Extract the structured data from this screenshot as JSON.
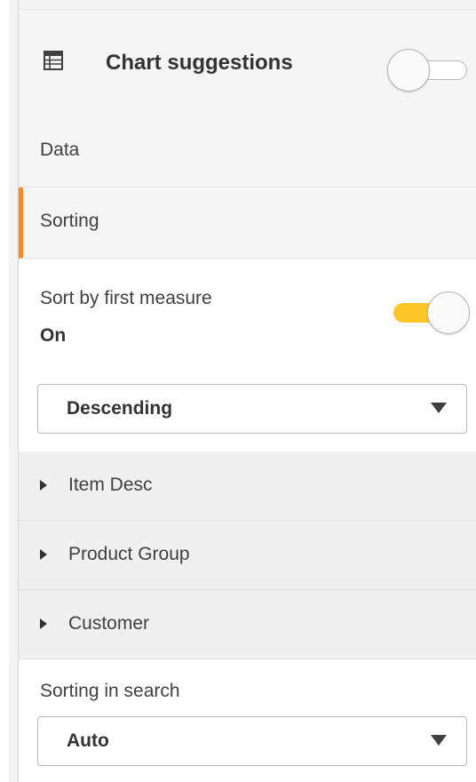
{
  "header": {
    "title": "Chart suggestions",
    "icon": "table-icon",
    "toggle_on": false
  },
  "nav": {
    "data_label": "Data",
    "sorting_label": "Sorting"
  },
  "sort": {
    "label": "Sort by first measure",
    "state": "On",
    "toggle_on": true,
    "order": "Descending"
  },
  "fields": [
    {
      "label": "Item Desc"
    },
    {
      "label": "Product Group"
    },
    {
      "label": "Customer"
    }
  ],
  "search": {
    "label": "Sorting in search",
    "value": "Auto"
  },
  "colors": {
    "accent": "#f08c29",
    "toggle_on": "#ffc629"
  }
}
